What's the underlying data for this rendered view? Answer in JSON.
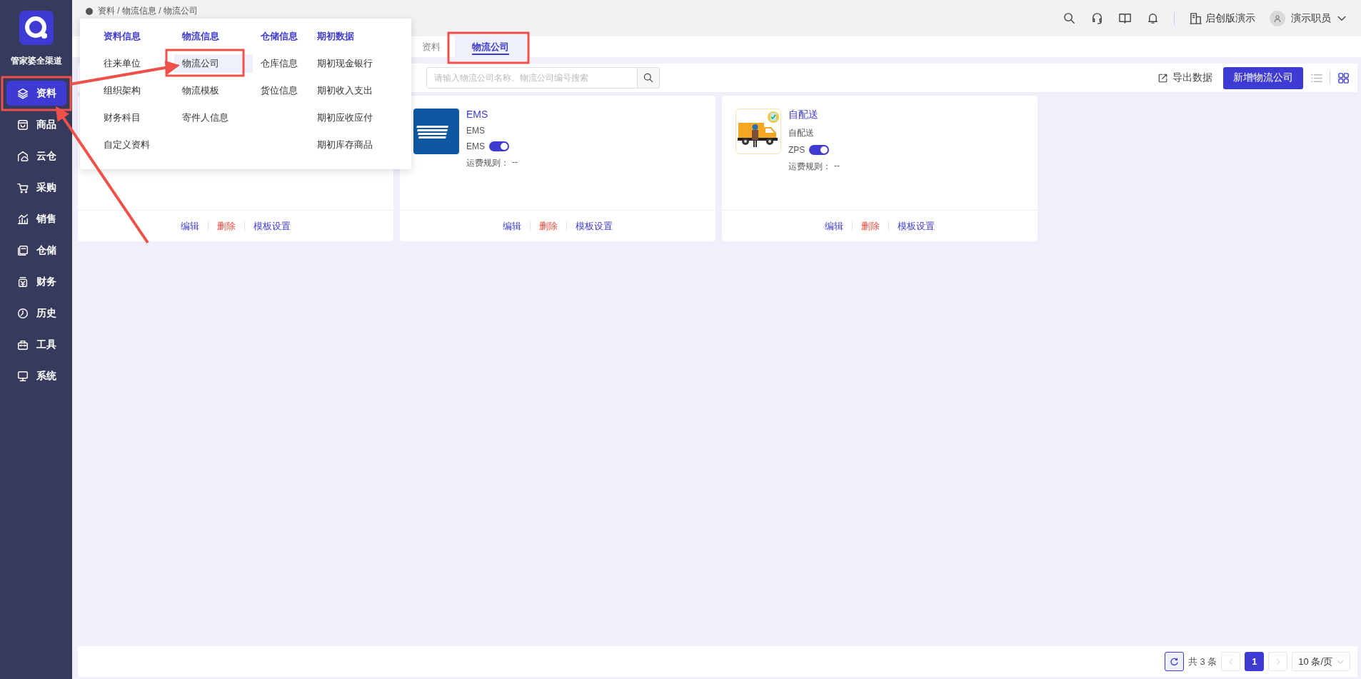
{
  "app": {
    "name": "管家婆全渠道"
  },
  "sidebar": {
    "items": [
      {
        "label": "资料",
        "selected": true
      },
      {
        "label": "商品",
        "selected": false
      },
      {
        "label": "云仓",
        "selected": false
      },
      {
        "label": "采购",
        "selected": false
      },
      {
        "label": "销售",
        "selected": false
      },
      {
        "label": "仓储",
        "selected": false
      },
      {
        "label": "财务",
        "selected": false
      },
      {
        "label": "历史",
        "selected": false
      },
      {
        "label": "工具",
        "selected": false
      },
      {
        "label": "系统",
        "selected": false
      }
    ]
  },
  "breadcrumb": "资料 / 物流信息 / 物流公司",
  "header": {
    "company": "启创版演示",
    "user": "演示职员"
  },
  "tabs": [
    {
      "label": "资料",
      "selected": false
    },
    {
      "label": "物流公司",
      "selected": true
    }
  ],
  "toolbar": {
    "search": {
      "placeholder": "请输入物流公司名称、物流公司编号搜索"
    },
    "export": "导出数据",
    "add_button": "新增物流公司"
  },
  "menu": {
    "columns": [
      {
        "title": "资料信息",
        "items": [
          {
            "label": "往来单位",
            "selected": false
          },
          {
            "label": "组织架构",
            "selected": false
          },
          {
            "label": "财务科目",
            "selected": false
          },
          {
            "label": "自定义资料",
            "selected": false
          }
        ]
      },
      {
        "title": "物流信息",
        "items": [
          {
            "label": "物流公司",
            "selected": true
          },
          {
            "label": "物流模板",
            "selected": false
          },
          {
            "label": "寄件人信息",
            "selected": false
          }
        ]
      },
      {
        "title": "仓储信息",
        "items": [
          {
            "label": "仓库信息",
            "selected": false
          },
          {
            "label": "货位信息",
            "selected": false
          }
        ]
      },
      {
        "title": "期初数据",
        "items": [
          {
            "label": "期初现金银行",
            "selected": false
          },
          {
            "label": "期初收入支出",
            "selected": false
          },
          {
            "label": "期初应收应付",
            "selected": false
          },
          {
            "label": "期初库存商品",
            "selected": false
          }
        ]
      }
    ]
  },
  "cards": [
    {
      "kind": "covered",
      "actions": [
        {
          "label": "编辑",
          "kind": "normal"
        },
        {
          "label": "删除",
          "kind": "danger"
        },
        {
          "label": "模板设置",
          "kind": "normal"
        }
      ]
    },
    {
      "kind": "full",
      "name": "EMS",
      "subtitle": "EMS",
      "code": "EMS",
      "on": true,
      "rule_label": "运费规则：",
      "rule": "--",
      "actions": [
        {
          "label": "编辑",
          "kind": "normal"
        },
        {
          "label": "删除",
          "kind": "danger"
        },
        {
          "label": "模板设置",
          "kind": "normal"
        }
      ]
    },
    {
      "kind": "full",
      "name": "自配送",
      "subtitle": "自配送",
      "code": "ZPS",
      "on": true,
      "rule_label": "运费规则：",
      "rule": "--",
      "actions": [
        {
          "label": "编辑",
          "kind": "normal"
        },
        {
          "label": "删除",
          "kind": "danger"
        },
        {
          "label": "模板设置",
          "kind": "normal"
        }
      ]
    }
  ],
  "pagination": {
    "total": "共 3 条",
    "pages": [
      {
        "label": "1",
        "selected": true
      }
    ],
    "page_size": "10 条/页"
  }
}
